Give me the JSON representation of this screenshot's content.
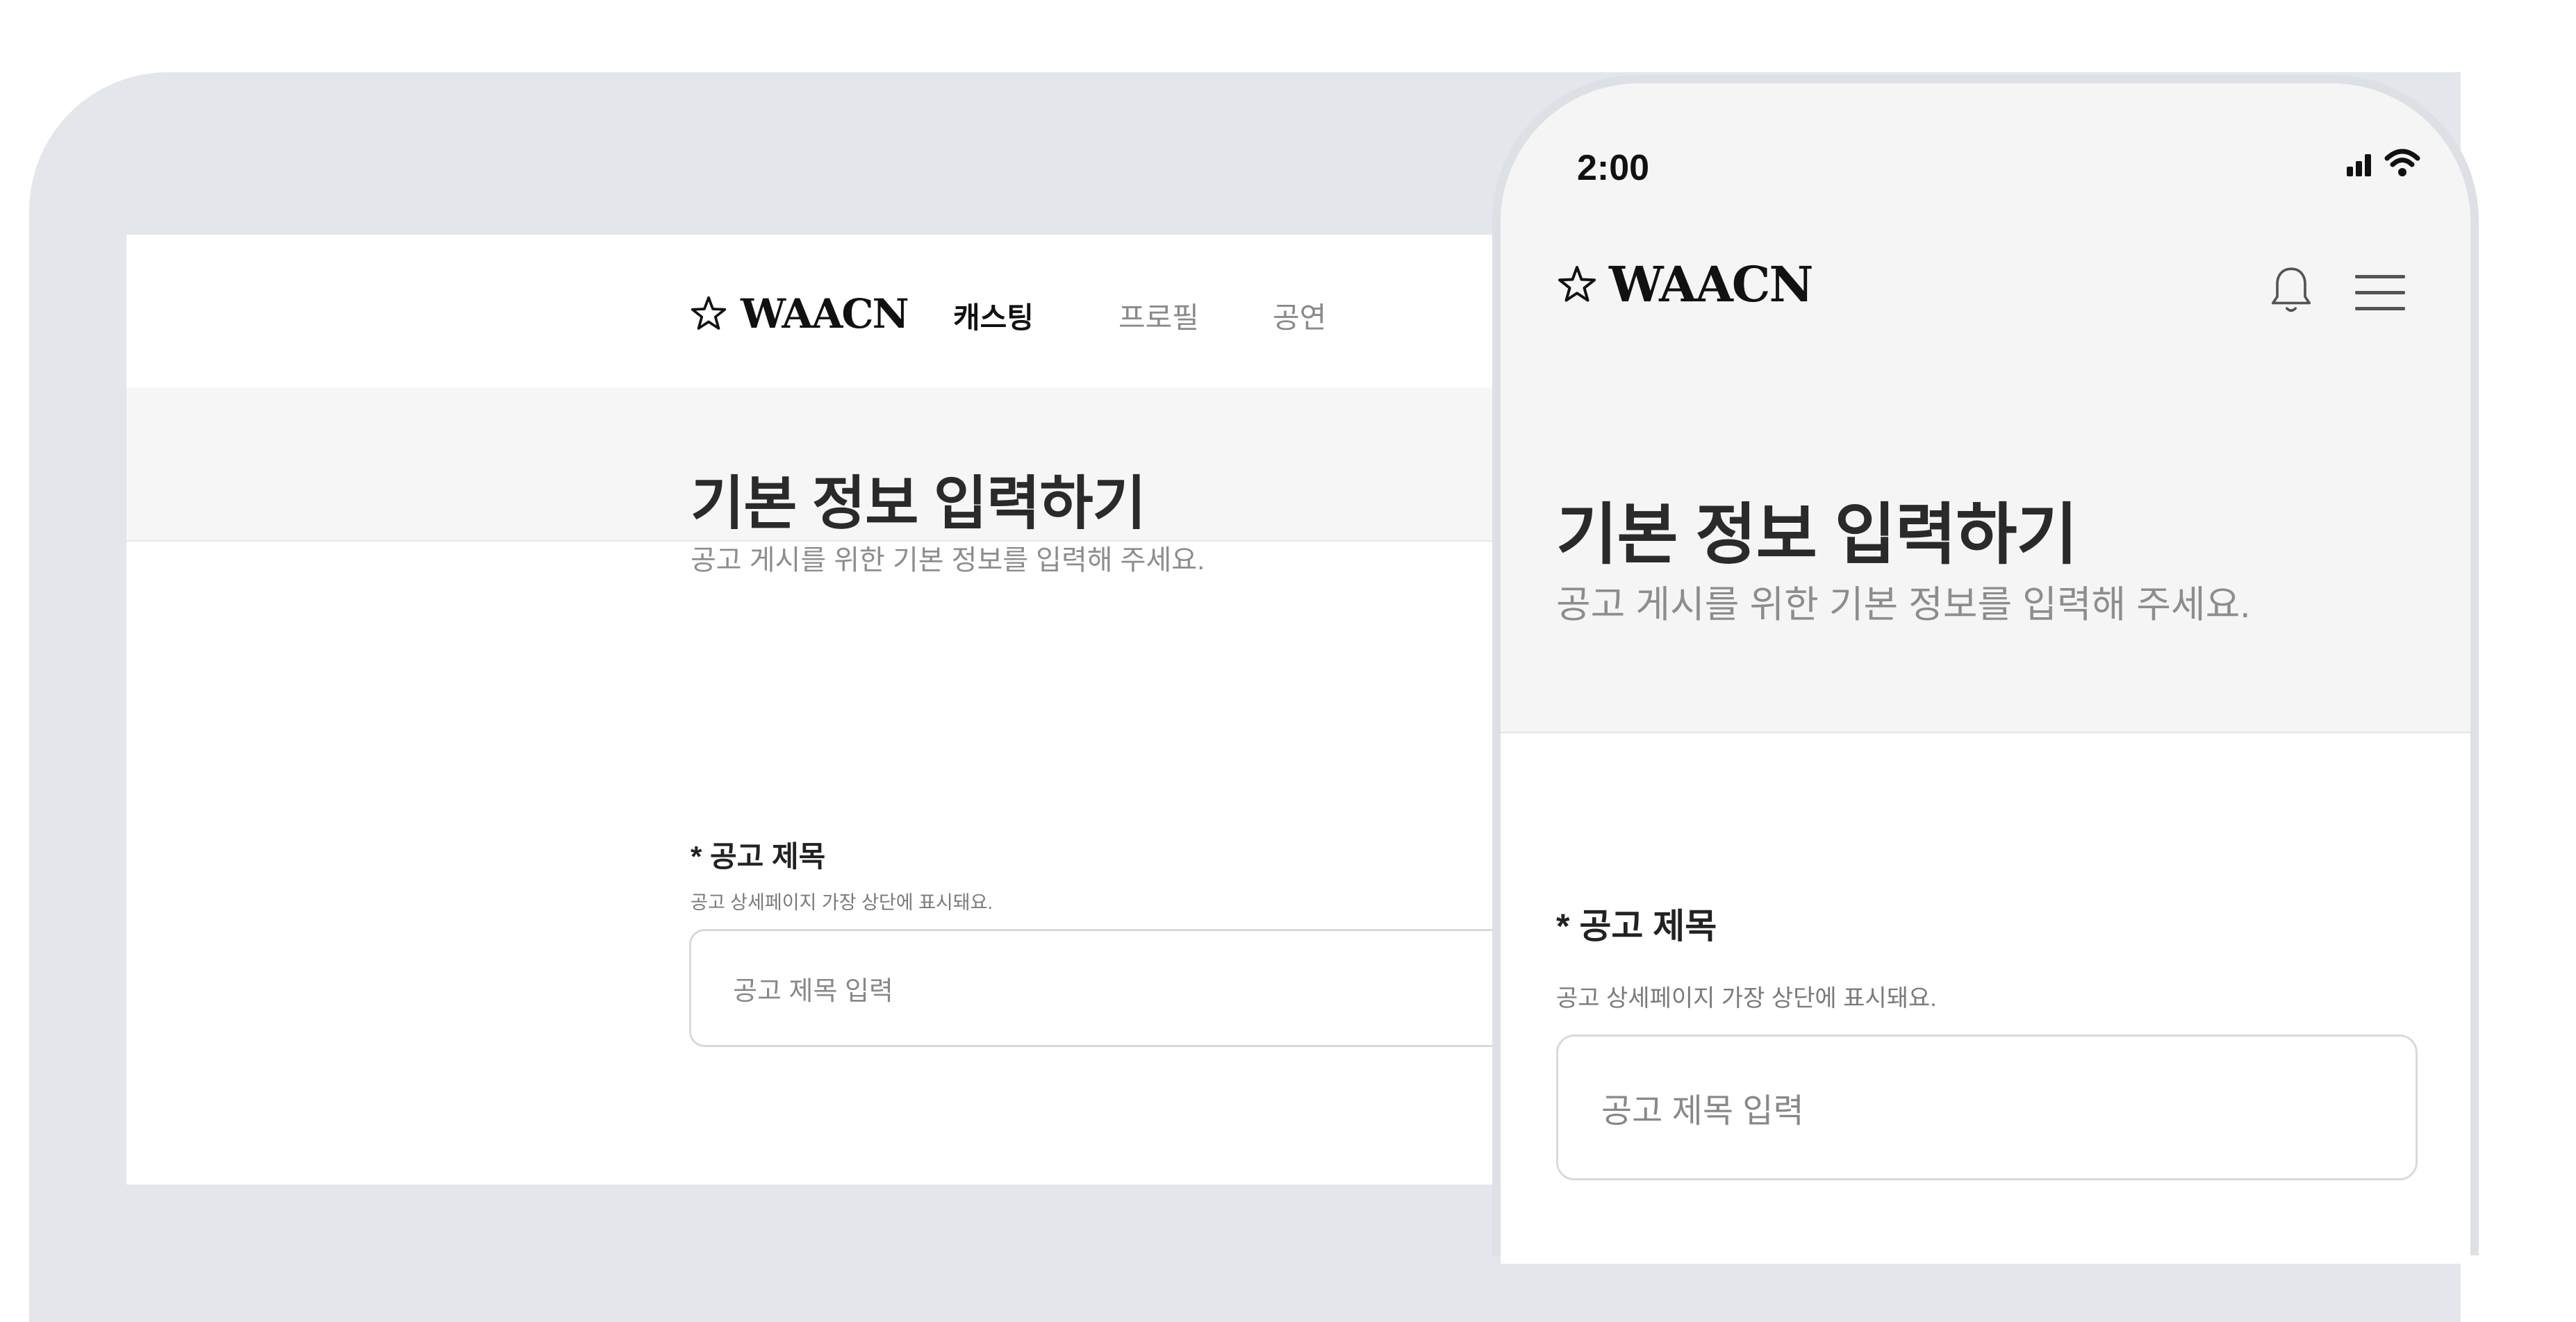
{
  "brand": {
    "name": "WAACN"
  },
  "desktop": {
    "nav": [
      {
        "label": "캐스팅",
        "active": true
      },
      {
        "label": "프로필",
        "active": false
      },
      {
        "label": "공연",
        "active": false
      }
    ],
    "hero": {
      "title": "기본 정보 입력하기",
      "subtitle": "공고 게시를 위한 기본 정보를 입력해 주세요."
    },
    "form": {
      "title_label": "* 공고 제목",
      "title_help": "공고 상세페이지 가장 상단에 표시돼요.",
      "title_placeholder": "공고 제목 입력"
    }
  },
  "mobile": {
    "status_bar": {
      "time": "2:00"
    },
    "hero": {
      "title": "기본 정보 입력하기",
      "subtitle": "공고 게시를 위한 기본 정보를 입력해 주세요."
    },
    "form": {
      "title_label": "* 공고 제목",
      "title_help": "공고 상세페이지 가장 상단에 표시돼요.",
      "title_placeholder": "공고 제목 입력"
    }
  },
  "icons": [
    "star-logo-icon",
    "bell-icon",
    "menu-icon",
    "signal-icon",
    "wifi-icon"
  ]
}
